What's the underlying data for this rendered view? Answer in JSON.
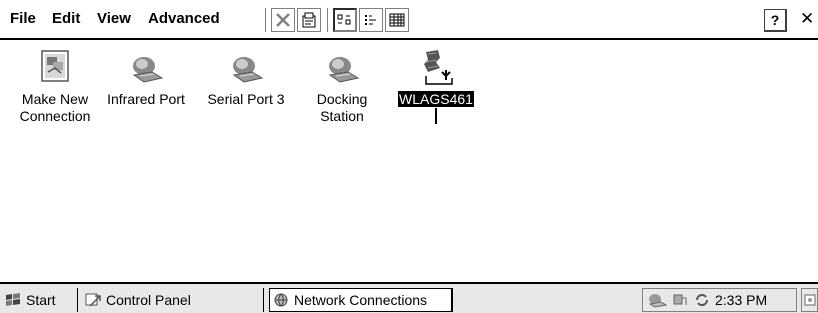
{
  "menu": {
    "file": "File",
    "edit": "Edit",
    "view": "View",
    "advanced": "Advanced"
  },
  "toolbar": {
    "buttons": [
      "delete-icon",
      "properties-icon",
      "large-icons-icon",
      "small-icons-icon",
      "details-icon"
    ],
    "help_label": "?",
    "close_label": "✕"
  },
  "connections": [
    {
      "line1": "Make New",
      "line2": "Connection",
      "icon": "new-connection-icon"
    },
    {
      "line1": "Infrared Port",
      "line2": "",
      "icon": "network-device-icon"
    },
    {
      "line1": "Serial Port 3",
      "line2": "",
      "icon": "network-device-icon"
    },
    {
      "line1": "Docking",
      "line2": "Station",
      "icon": "network-device-icon"
    },
    {
      "line1": "WLAGS461",
      "line2": "",
      "icon": "wireless-adapter-icon",
      "selected": true
    }
  ],
  "taskbar": {
    "start_label": "Start",
    "control_panel_label": "Control Panel",
    "network_connections_label": "Network Connections",
    "clock": "2:33 PM"
  }
}
